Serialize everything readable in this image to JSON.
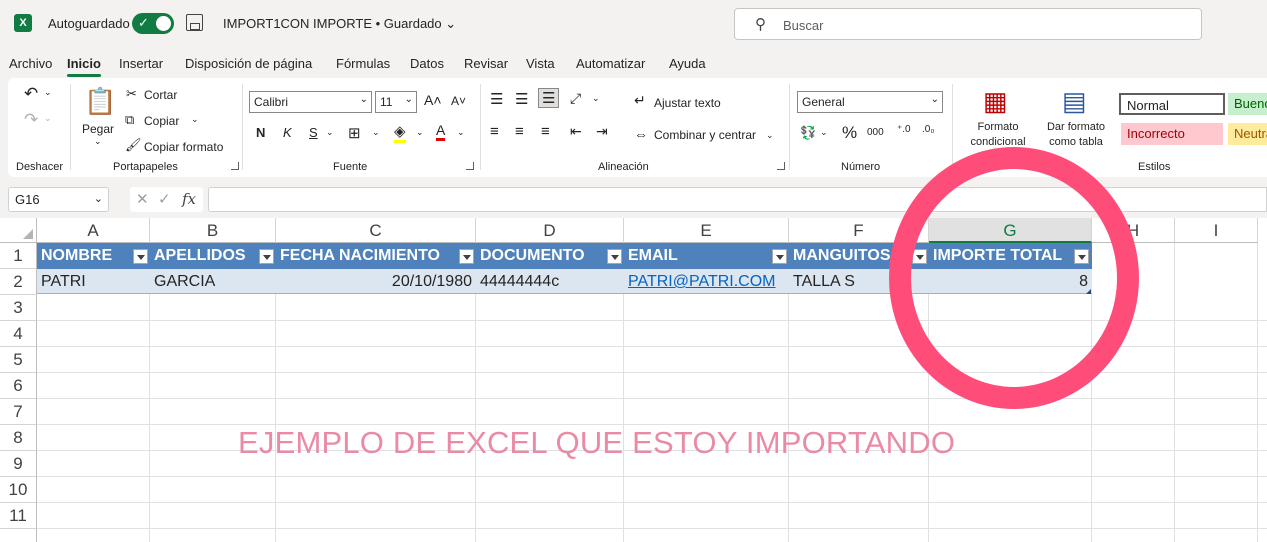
{
  "titlebar": {
    "app_icon": "excel-icon",
    "autosave_label": "Autoguardado",
    "autosave_on": true,
    "doc_title": "IMPORT1CON IMPORTE • Guardado ⌄",
    "search_placeholder": "Buscar"
  },
  "menu": [
    "Archivo",
    "Inicio",
    "Insertar",
    "Disposición de página",
    "Fórmulas",
    "Datos",
    "Revisar",
    "Vista",
    "Automatizar",
    "Ayuda"
  ],
  "menu_active": "Inicio",
  "ribbon": {
    "undo_group": "Deshacer",
    "clipboard": {
      "paste": "Pegar",
      "cut": "Cortar",
      "copy": "Copiar",
      "format_painter": "Copiar formato",
      "group": "Portapapeles"
    },
    "font": {
      "name": "Calibri",
      "size": "11",
      "bold": "N",
      "italic": "K",
      "underline": "S",
      "group": "Fuente"
    },
    "alignment": {
      "wrap": "Ajustar texto",
      "merge": "Combinar y centrar",
      "group": "Alineación"
    },
    "number": {
      "format": "General",
      "group": "Número"
    },
    "styles": {
      "conditional": "Formato condicional",
      "as_table": "Dar formato como tabla",
      "normal": "Normal",
      "good": "Bueno",
      "bad": "Incorrecto",
      "neutral": "Neutral",
      "group": "Estilos"
    }
  },
  "formula_bar": {
    "name_box": "G16",
    "value": ""
  },
  "columns": [
    "A",
    "B",
    "C",
    "D",
    "E",
    "F",
    "G",
    "H",
    "I"
  ],
  "selected_column": "G",
  "rows": [
    "1",
    "2",
    "3",
    "4",
    "5",
    "6",
    "7",
    "8",
    "9",
    "10",
    "11"
  ],
  "table": {
    "headers": [
      "NOMBRE",
      "APELLIDOS",
      "FECHA NACIMIENTO",
      "DOCUMENTO",
      "EMAIL",
      "MANGUITOS",
      "IMPORTE TOTAL"
    ],
    "row": [
      "PATRI",
      "GARCIA",
      "20/10/1980",
      "44444444c",
      "PATRI@PATRI.COM",
      "TALLA S",
      "8"
    ]
  },
  "annotation": {
    "text": "EJEMPLO DE EXCEL QUE ESTOY IMPORTANDO",
    "color": "#ea8aa5",
    "ring_color": "#ff4d7a"
  },
  "colors": {
    "excel_green": "#107c41",
    "table_header": "#4f81bd",
    "table_band": "#dce6f1"
  }
}
